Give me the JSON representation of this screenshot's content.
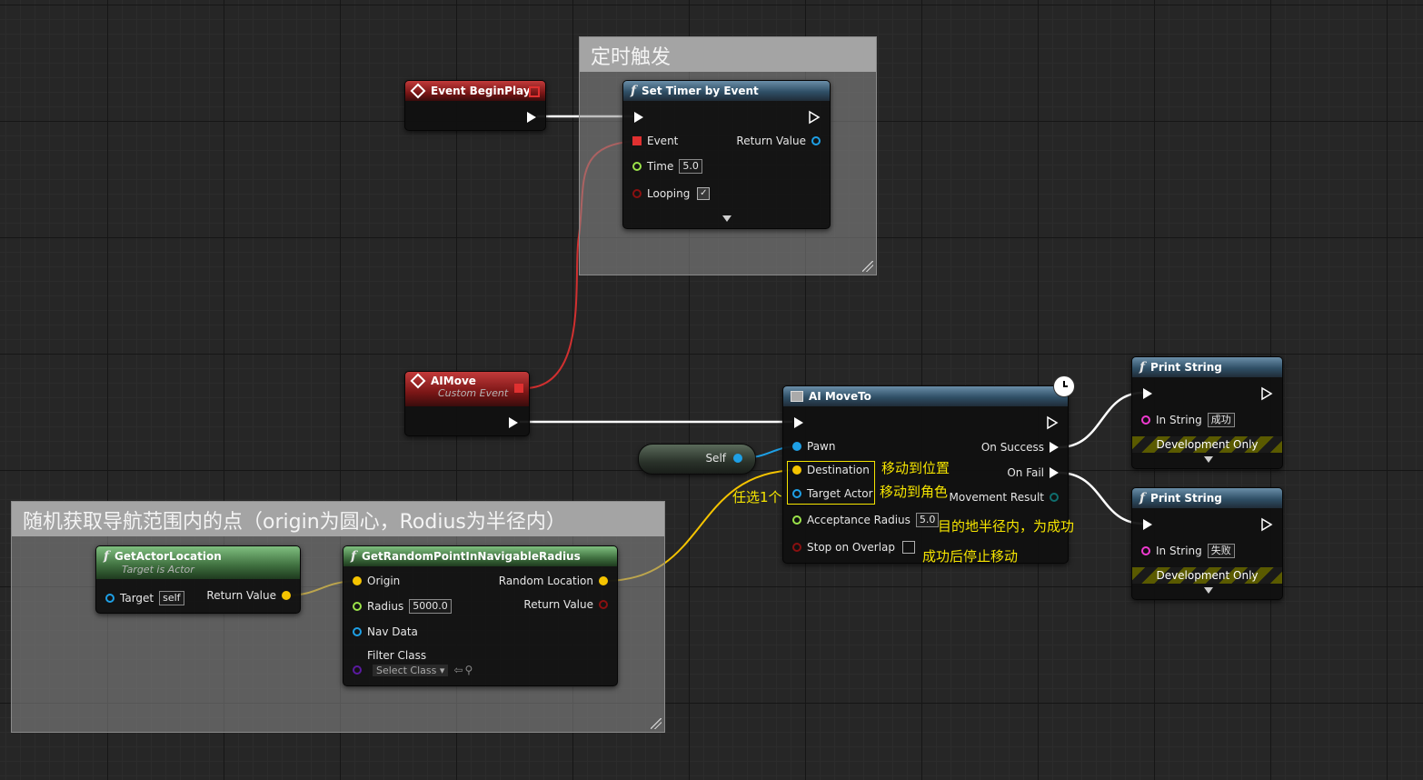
{
  "comments": {
    "timer_title": "定时触发",
    "random_title": "随机获取导航范围内的点（origin为圆心，Rodius为半径内）"
  },
  "event_beginplay": {
    "title": "Event BeginPlay"
  },
  "set_timer": {
    "title": "Set Timer by Event",
    "event_label": "Event",
    "return_label": "Return Value",
    "time_label": "Time",
    "time_value": "5.0",
    "looping_label": "Looping",
    "looping_checked": true
  },
  "aimove": {
    "title": "AIMove",
    "subtitle": "Custom Event"
  },
  "self_node": {
    "label": "Self"
  },
  "ai_moveto": {
    "title": "AI MoveTo",
    "pawn": "Pawn",
    "destination": "Destination",
    "target_actor": "Target Actor",
    "acceptance_radius": "Acceptance Radius",
    "acceptance_value": "5.0",
    "stop_on_overlap": "Stop on Overlap",
    "on_success": "On Success",
    "on_fail": "On Fail",
    "movement_result": "Movement Result"
  },
  "annotations": {
    "move_to_position": "移动到位置",
    "move_to_actor": "移动到角色",
    "pick_one": "任选1个",
    "radius_success": "目的地半径内，为成功",
    "stop_after_success": "成功后停止移动"
  },
  "print_success": {
    "title": "Print String",
    "in_string_label": "In String",
    "in_string_value": "成功",
    "dev_only": "Development Only"
  },
  "print_fail": {
    "title": "Print String",
    "in_string_label": "In String",
    "in_string_value": "失败",
    "dev_only": "Development Only"
  },
  "get_actor_location": {
    "title": "GetActorLocation",
    "subtitle": "Target is Actor",
    "target_label": "Target",
    "target_value": "self",
    "return_label": "Return Value"
  },
  "get_random_point": {
    "title": "GetRandomPointInNavigableRadius",
    "origin": "Origin",
    "random_location": "Random Location",
    "radius": "Radius",
    "radius_value": "5000.0",
    "return_label": "Return Value",
    "nav_data": "Nav Data",
    "filter_class": "Filter Class",
    "select_class": "Select Class"
  },
  "colors": {
    "exec": "#ffffff",
    "object_pin": "#1ea0e6",
    "vector_pin": "#f5c400",
    "float_pin": "#9be34a",
    "bool_pin": "#8a1010",
    "delegate_pin": "#e03030",
    "string_pin": "#f03ad0",
    "annotation": "#f5e400"
  }
}
